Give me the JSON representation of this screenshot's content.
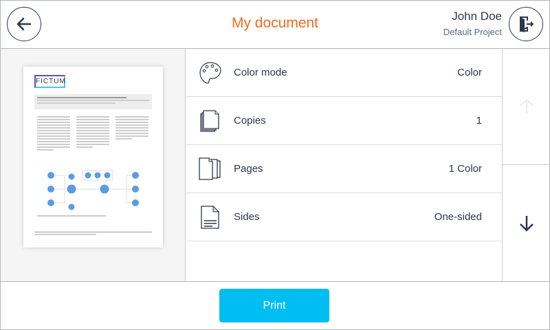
{
  "header": {
    "title": "My document",
    "user_name": "John Doe",
    "project": "Default Project",
    "back_icon": "arrow-left-icon",
    "logout_icon": "logout-door-icon"
  },
  "preview": {
    "logo": "FICTUM"
  },
  "options": [
    {
      "icon": "palette-icon",
      "label": "Color mode",
      "value": "Color"
    },
    {
      "icon": "copies-icon",
      "label": "Copies",
      "value": "1"
    },
    {
      "icon": "pages-icon",
      "label": "Pages",
      "value": "1 Color"
    },
    {
      "icon": "document-icon",
      "label": "Sides",
      "value": "One-sided"
    }
  ],
  "scroll": {
    "up_icon": "arrow-up-icon",
    "down_icon": "arrow-down-icon"
  },
  "footer": {
    "print_label": "Print"
  },
  "colors": {
    "accent": "#f26b1d",
    "print_button": "#00bdf2",
    "text": "#2d3748"
  }
}
